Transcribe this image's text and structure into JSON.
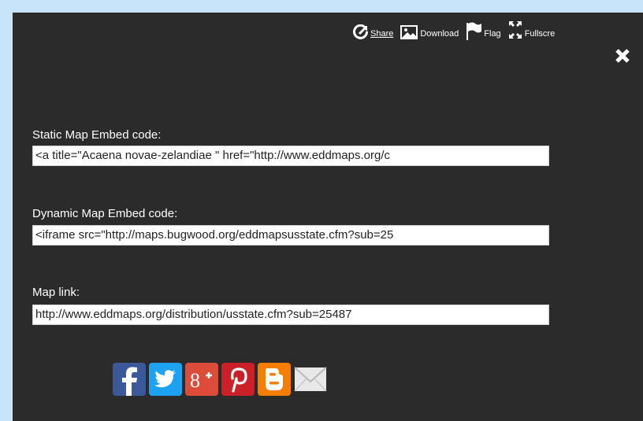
{
  "toolbar": {
    "share_label": "Share",
    "download_label": "Download",
    "flag_label": "Flag",
    "fullscreen_label": "Fullscre"
  },
  "fields": {
    "static": {
      "label": "Static Map Embed code:",
      "value": "<a title=\"Acaena novae-zelandiae  \" href=\"http://www.eddmaps.org/c"
    },
    "dynamic": {
      "label": "Dynamic Map Embed code:",
      "value": "<iframe src=\"http://maps.bugwood.org/eddmapsusstate.cfm?sub=25"
    },
    "link": {
      "label": "Map link:",
      "value": "http://www.eddmaps.org/distribution/usstate.cfm?sub=25487"
    }
  },
  "social": [
    {
      "icon": "facebook-icon",
      "color": "#3b5998"
    },
    {
      "icon": "twitter-icon",
      "color": "#1da1f2"
    },
    {
      "icon": "google-plus-icon",
      "color": "#dd4b39"
    },
    {
      "icon": "pinterest-icon",
      "color": "#cb2027"
    },
    {
      "icon": "blogger-icon",
      "color": "#f57d00"
    },
    {
      "icon": "email-icon",
      "color": "#e8e8e8"
    }
  ],
  "colors": {
    "page_background": "#c8e4fa",
    "panel_background": "#2b2b2b"
  }
}
